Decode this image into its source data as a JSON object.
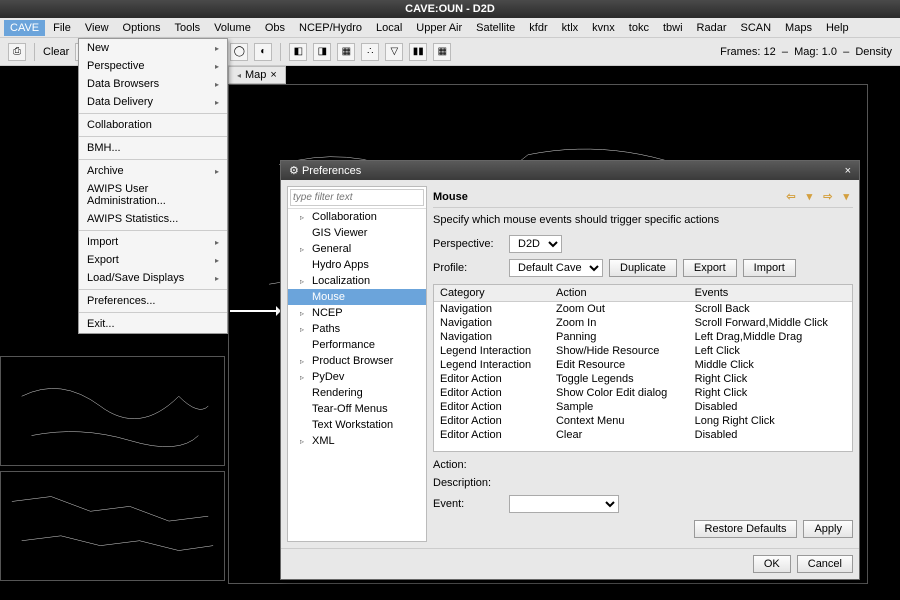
{
  "window_title": "CAVE:OUN - D2D",
  "menubar": [
    "CAVE",
    "File",
    "View",
    "Options",
    "Tools",
    "Volume",
    "Obs",
    "NCEP/Hydro",
    "Local",
    "Upper Air",
    "Satellite",
    "kfdr",
    "ktlx",
    "kvnx",
    "tokc",
    "tbwi",
    "Radar",
    "SCAN",
    "Maps",
    "Help"
  ],
  "menubar_active": "CAVE",
  "toolbar": {
    "clear": "Clear",
    "frames_label": "Frames:",
    "frames_value": "12",
    "mag_label": "Mag:",
    "mag_value": "1.0",
    "density_label": "Density"
  },
  "tab_label": "Map",
  "dropdown_items": [
    {
      "label": "New",
      "sub": true
    },
    {
      "label": "Perspective",
      "sub": true
    },
    {
      "label": "Data Browsers",
      "sub": true
    },
    {
      "label": "Data Delivery",
      "sub": true
    },
    {
      "sep": true
    },
    {
      "label": "Collaboration"
    },
    {
      "sep": true
    },
    {
      "label": "BMH..."
    },
    {
      "sep": true
    },
    {
      "label": "Archive",
      "sub": true
    },
    {
      "label": "AWIPS User Administration..."
    },
    {
      "label": "AWIPS Statistics..."
    },
    {
      "sep": true
    },
    {
      "label": "Import",
      "sub": true
    },
    {
      "label": "Export",
      "sub": true
    },
    {
      "label": "Load/Save Displays",
      "sub": true
    },
    {
      "sep": true
    },
    {
      "label": "Preferences..."
    },
    {
      "sep": true
    },
    {
      "label": "Exit..."
    }
  ],
  "pref": {
    "title": "Preferences",
    "filter_placeholder": "type filter text",
    "tree": [
      {
        "label": "Collaboration",
        "sub": true
      },
      {
        "label": "GIS Viewer"
      },
      {
        "label": "General",
        "sub": true
      },
      {
        "label": "Hydro Apps"
      },
      {
        "label": "Localization",
        "sub": true
      },
      {
        "label": "Mouse",
        "sel": true
      },
      {
        "label": "NCEP",
        "sub": true
      },
      {
        "label": "Paths",
        "sub": true
      },
      {
        "label": "Performance"
      },
      {
        "label": "Product Browser",
        "sub": true
      },
      {
        "label": "PyDev",
        "sub": true
      },
      {
        "label": "Rendering"
      },
      {
        "label": "Tear-Off Menus"
      },
      {
        "label": "Text Workstation"
      },
      {
        "label": "XML",
        "sub": true
      }
    ],
    "heading": "Mouse",
    "desc": "Specify which mouse events should trigger specific actions",
    "perspective_label": "Perspective:",
    "perspective_value": "D2D",
    "profile_label": "Profile:",
    "profile_value": "Default Cave",
    "btn_duplicate": "Duplicate",
    "btn_export": "Export",
    "btn_import": "Import",
    "cols": [
      "Category",
      "Action",
      "Events"
    ],
    "rows": [
      [
        "Navigation",
        "Zoom Out",
        "Scroll Back"
      ],
      [
        "Navigation",
        "Zoom In",
        "Scroll Forward,Middle Click"
      ],
      [
        "Navigation",
        "Panning",
        "Left Drag,Middle Drag"
      ],
      [
        "Legend Interaction",
        "Show/Hide Resource",
        "Left Click"
      ],
      [
        "Legend Interaction",
        "Edit Resource",
        "Middle Click"
      ],
      [
        "Editor Action",
        "Toggle Legends",
        "Right Click"
      ],
      [
        "Editor Action",
        "Show Color Edit dialog",
        "Right Click"
      ],
      [
        "Editor Action",
        "Sample",
        "Disabled"
      ],
      [
        "Editor Action",
        "Context Menu",
        "Long Right Click"
      ],
      [
        "Editor Action",
        "Clear",
        "Disabled"
      ]
    ],
    "action_label": "Action:",
    "description_label": "Description:",
    "event_label": "Event:",
    "restore": "Restore Defaults",
    "apply": "Apply",
    "ok": "OK",
    "cancel": "Cancel"
  }
}
